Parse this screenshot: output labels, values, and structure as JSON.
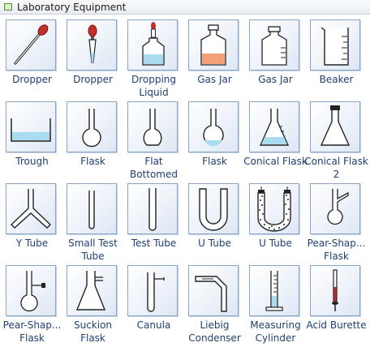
{
  "panel": {
    "title": "Laboratory Equipment"
  },
  "items": [
    {
      "label": "Dropper",
      "icon": "dropper-icon"
    },
    {
      "label": "Dropper",
      "icon": "dropper-bulb-icon"
    },
    {
      "label": "Dropping Liquid",
      "icon": "dropping-liquid-bottle-icon"
    },
    {
      "label": "Gas Jar",
      "icon": "gas-jar-icon"
    },
    {
      "label": "Gas Jar",
      "icon": "gas-jar-empty-icon"
    },
    {
      "label": "Beaker",
      "icon": "beaker-icon"
    },
    {
      "label": "Trough",
      "icon": "trough-icon"
    },
    {
      "label": "Flask",
      "icon": "round-flask-icon"
    },
    {
      "label": "Flat Bottomed",
      "icon": "flat-bottomed-flask-icon"
    },
    {
      "label": "Flask",
      "icon": "round-flask-filled-icon"
    },
    {
      "label": "Conical Flask",
      "icon": "conical-flask-icon"
    },
    {
      "label": "Conical Flask 2",
      "icon": "conical-flask-stoppered-icon"
    },
    {
      "label": "Y Tube",
      "icon": "y-tube-icon"
    },
    {
      "label": "Small Test Tube",
      "icon": "small-test-tube-icon"
    },
    {
      "label": "Test Tube",
      "icon": "test-tube-icon"
    },
    {
      "label": "U Tube",
      "icon": "u-tube-icon"
    },
    {
      "label": "U Tube",
      "icon": "u-tube-filled-icon"
    },
    {
      "label": "Pear-Shap... Flask",
      "icon": "pear-shaped-flask-icon"
    },
    {
      "label": "Pear-Shap... Flask",
      "icon": "pear-shaped-flask-side-arm-icon"
    },
    {
      "label": "Suckion Flask",
      "icon": "suction-flask-icon"
    },
    {
      "label": "Canula",
      "icon": "cannula-icon"
    },
    {
      "label": "Liebig Condenser",
      "icon": "liebig-condenser-icon"
    },
    {
      "label": "Measuring Cylinder",
      "icon": "measuring-cylinder-icon"
    },
    {
      "label": "Acid Burette",
      "icon": "acid-burette-icon"
    }
  ],
  "colors": {
    "label": "#1f3f73",
    "tile_border": "#8aa4c4",
    "liquid_blue": "#a9dcf0",
    "liquid_orange": "#f2a07a",
    "dropper_red": "#c0302a"
  }
}
